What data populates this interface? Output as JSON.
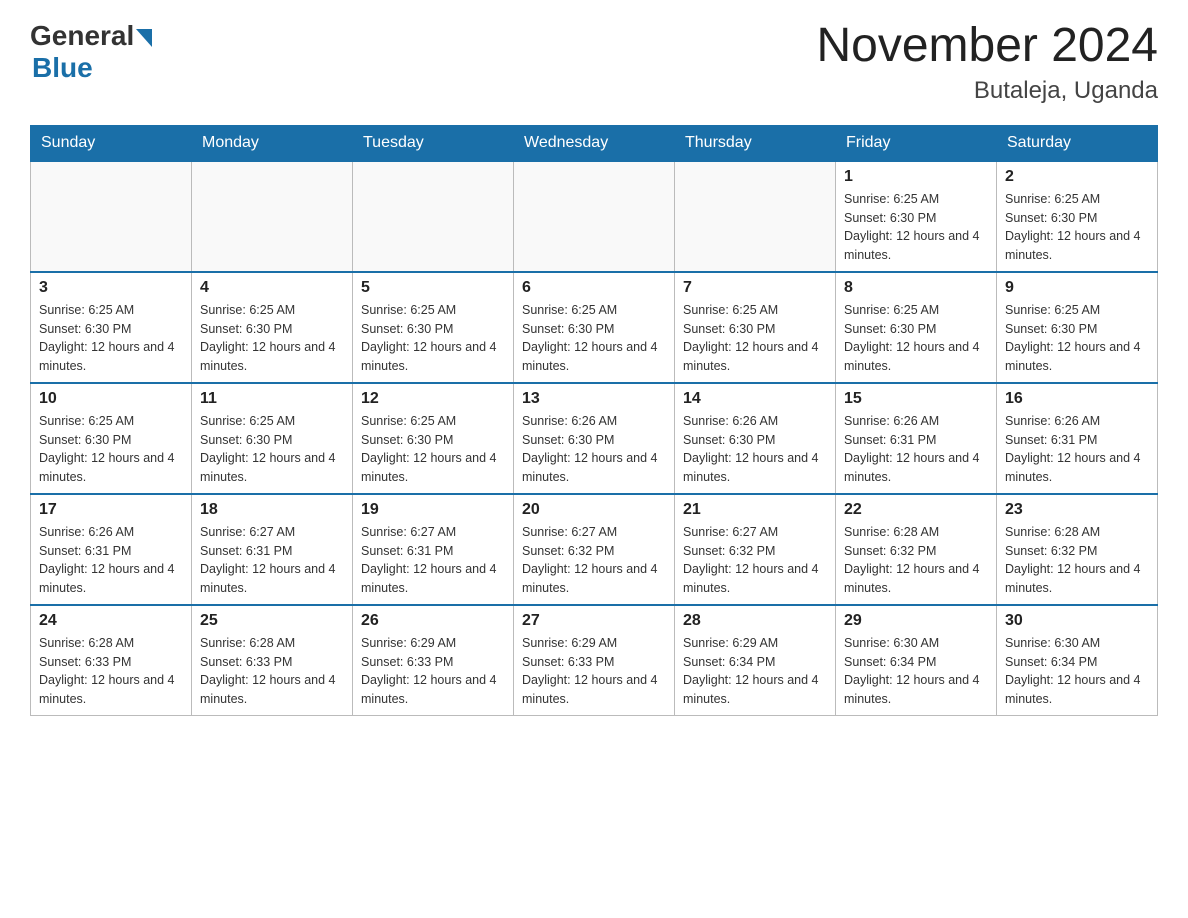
{
  "header": {
    "logo_general": "General",
    "logo_blue": "Blue",
    "title": "November 2024",
    "subtitle": "Butaleja, Uganda"
  },
  "calendar": {
    "days_of_week": [
      "Sunday",
      "Monday",
      "Tuesday",
      "Wednesday",
      "Thursday",
      "Friday",
      "Saturday"
    ],
    "weeks": [
      [
        {
          "day": "",
          "info": ""
        },
        {
          "day": "",
          "info": ""
        },
        {
          "day": "",
          "info": ""
        },
        {
          "day": "",
          "info": ""
        },
        {
          "day": "",
          "info": ""
        },
        {
          "day": "1",
          "info": "Sunrise: 6:25 AM\nSunset: 6:30 PM\nDaylight: 12 hours and 4 minutes."
        },
        {
          "day": "2",
          "info": "Sunrise: 6:25 AM\nSunset: 6:30 PM\nDaylight: 12 hours and 4 minutes."
        }
      ],
      [
        {
          "day": "3",
          "info": "Sunrise: 6:25 AM\nSunset: 6:30 PM\nDaylight: 12 hours and 4 minutes."
        },
        {
          "day": "4",
          "info": "Sunrise: 6:25 AM\nSunset: 6:30 PM\nDaylight: 12 hours and 4 minutes."
        },
        {
          "day": "5",
          "info": "Sunrise: 6:25 AM\nSunset: 6:30 PM\nDaylight: 12 hours and 4 minutes."
        },
        {
          "day": "6",
          "info": "Sunrise: 6:25 AM\nSunset: 6:30 PM\nDaylight: 12 hours and 4 minutes."
        },
        {
          "day": "7",
          "info": "Sunrise: 6:25 AM\nSunset: 6:30 PM\nDaylight: 12 hours and 4 minutes."
        },
        {
          "day": "8",
          "info": "Sunrise: 6:25 AM\nSunset: 6:30 PM\nDaylight: 12 hours and 4 minutes."
        },
        {
          "day": "9",
          "info": "Sunrise: 6:25 AM\nSunset: 6:30 PM\nDaylight: 12 hours and 4 minutes."
        }
      ],
      [
        {
          "day": "10",
          "info": "Sunrise: 6:25 AM\nSunset: 6:30 PM\nDaylight: 12 hours and 4 minutes."
        },
        {
          "day": "11",
          "info": "Sunrise: 6:25 AM\nSunset: 6:30 PM\nDaylight: 12 hours and 4 minutes."
        },
        {
          "day": "12",
          "info": "Sunrise: 6:25 AM\nSunset: 6:30 PM\nDaylight: 12 hours and 4 minutes."
        },
        {
          "day": "13",
          "info": "Sunrise: 6:26 AM\nSunset: 6:30 PM\nDaylight: 12 hours and 4 minutes."
        },
        {
          "day": "14",
          "info": "Sunrise: 6:26 AM\nSunset: 6:30 PM\nDaylight: 12 hours and 4 minutes."
        },
        {
          "day": "15",
          "info": "Sunrise: 6:26 AM\nSunset: 6:31 PM\nDaylight: 12 hours and 4 minutes."
        },
        {
          "day": "16",
          "info": "Sunrise: 6:26 AM\nSunset: 6:31 PM\nDaylight: 12 hours and 4 minutes."
        }
      ],
      [
        {
          "day": "17",
          "info": "Sunrise: 6:26 AM\nSunset: 6:31 PM\nDaylight: 12 hours and 4 minutes."
        },
        {
          "day": "18",
          "info": "Sunrise: 6:27 AM\nSunset: 6:31 PM\nDaylight: 12 hours and 4 minutes."
        },
        {
          "day": "19",
          "info": "Sunrise: 6:27 AM\nSunset: 6:31 PM\nDaylight: 12 hours and 4 minutes."
        },
        {
          "day": "20",
          "info": "Sunrise: 6:27 AM\nSunset: 6:32 PM\nDaylight: 12 hours and 4 minutes."
        },
        {
          "day": "21",
          "info": "Sunrise: 6:27 AM\nSunset: 6:32 PM\nDaylight: 12 hours and 4 minutes."
        },
        {
          "day": "22",
          "info": "Sunrise: 6:28 AM\nSunset: 6:32 PM\nDaylight: 12 hours and 4 minutes."
        },
        {
          "day": "23",
          "info": "Sunrise: 6:28 AM\nSunset: 6:32 PM\nDaylight: 12 hours and 4 minutes."
        }
      ],
      [
        {
          "day": "24",
          "info": "Sunrise: 6:28 AM\nSunset: 6:33 PM\nDaylight: 12 hours and 4 minutes."
        },
        {
          "day": "25",
          "info": "Sunrise: 6:28 AM\nSunset: 6:33 PM\nDaylight: 12 hours and 4 minutes."
        },
        {
          "day": "26",
          "info": "Sunrise: 6:29 AM\nSunset: 6:33 PM\nDaylight: 12 hours and 4 minutes."
        },
        {
          "day": "27",
          "info": "Sunrise: 6:29 AM\nSunset: 6:33 PM\nDaylight: 12 hours and 4 minutes."
        },
        {
          "day": "28",
          "info": "Sunrise: 6:29 AM\nSunset: 6:34 PM\nDaylight: 12 hours and 4 minutes."
        },
        {
          "day": "29",
          "info": "Sunrise: 6:30 AM\nSunset: 6:34 PM\nDaylight: 12 hours and 4 minutes."
        },
        {
          "day": "30",
          "info": "Sunrise: 6:30 AM\nSunset: 6:34 PM\nDaylight: 12 hours and 4 minutes."
        }
      ]
    ]
  }
}
